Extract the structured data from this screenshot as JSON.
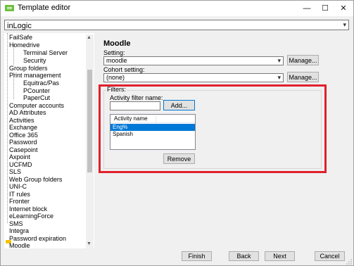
{
  "window": {
    "title": "Template editor",
    "minimize": "—",
    "maximize": "☐",
    "close": "✕"
  },
  "top_combo": {
    "value": "inLogic"
  },
  "tree": {
    "items": [
      {
        "label": "FailSafe"
      },
      {
        "label": "Homedrive"
      },
      {
        "label": "Terminal Server"
      },
      {
        "label": "Security"
      },
      {
        "label": "Group folders"
      },
      {
        "label": "Print management"
      },
      {
        "label": "Equitrac/Pas"
      },
      {
        "label": "PCounter"
      },
      {
        "label": "PaperCut"
      },
      {
        "label": "Computer accounts"
      },
      {
        "label": "AD Attributes"
      },
      {
        "label": "Activities"
      },
      {
        "label": "Exchange"
      },
      {
        "label": "Office 365"
      },
      {
        "label": "Password"
      },
      {
        "label": "Casepoint"
      },
      {
        "label": "Axpoint"
      },
      {
        "label": "UCFMD"
      },
      {
        "label": "SLS"
      },
      {
        "label": "Web Group folders"
      },
      {
        "label": "UNI-C"
      },
      {
        "label": "IT rules"
      },
      {
        "label": "Fronter"
      },
      {
        "label": "Internet block"
      },
      {
        "label": "eLearningForce"
      },
      {
        "label": "SMS"
      },
      {
        "label": "Integra"
      },
      {
        "label": "Password expiration"
      },
      {
        "label": "Moodle"
      }
    ]
  },
  "main": {
    "heading": "Moodle",
    "setting_label": "Setting:",
    "setting_value": "moodle",
    "cohort_label": "Cohort setting:",
    "cohort_value": "(none)",
    "manage_label": "Manage...",
    "filters_label": "Filters:",
    "activity_filter_label": "Activity filter name:",
    "activity_filter_value": "",
    "add_label": "Add...",
    "list_header": "Activity name",
    "list_rows": [
      {
        "label": "Eng%"
      },
      {
        "label": "Spanish"
      }
    ],
    "remove_label": "Remove"
  },
  "footer": {
    "finish": "Finish",
    "back": "Back",
    "next": "Next",
    "cancel": "Cancel"
  },
  "colors": {
    "accent": "#0078d7",
    "highlight_box": "#e0212b",
    "app_icon": "#6cbf3c"
  }
}
